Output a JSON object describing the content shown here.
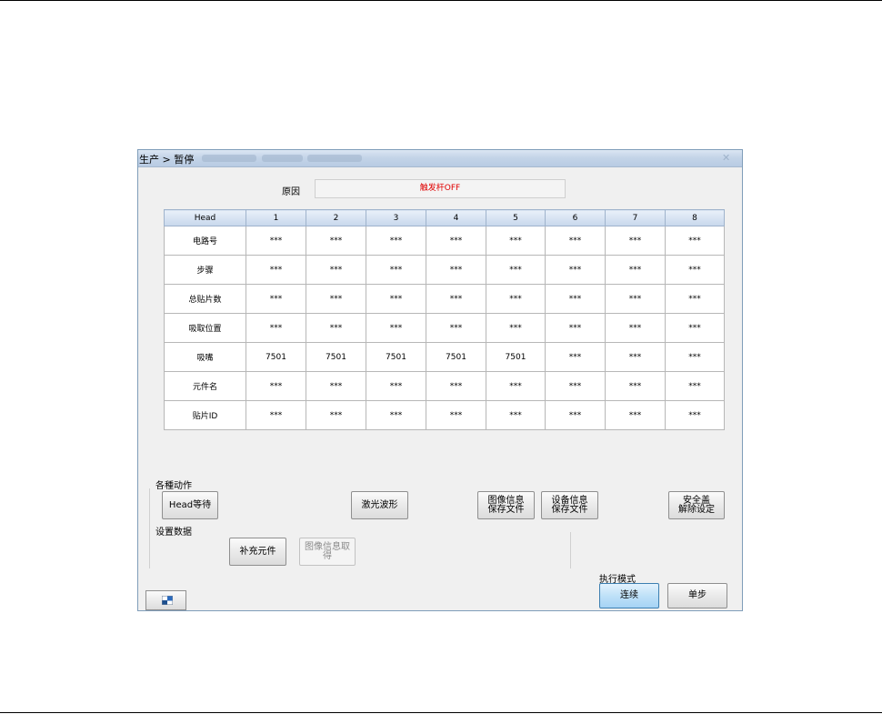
{
  "window": {
    "title": "生产 > 暂停"
  },
  "cause": {
    "label": "原因",
    "value": "触发杆OFF"
  },
  "table": {
    "columns": [
      "Head",
      "1",
      "2",
      "3",
      "4",
      "5",
      "6",
      "7",
      "8"
    ],
    "rows": [
      {
        "label": "电路号",
        "cells": [
          "***",
          "***",
          "***",
          "***",
          "***",
          "***",
          "***",
          "***"
        ]
      },
      {
        "label": "步骤",
        "cells": [
          "***",
          "***",
          "***",
          "***",
          "***",
          "***",
          "***",
          "***"
        ]
      },
      {
        "label": "总贴片数",
        "cells": [
          "***",
          "***",
          "***",
          "***",
          "***",
          "***",
          "***",
          "***"
        ]
      },
      {
        "label": "吸取位置",
        "cells": [
          "***",
          "***",
          "***",
          "***",
          "***",
          "***",
          "***",
          "***"
        ]
      },
      {
        "label": "吸嘴",
        "cells": [
          "7501",
          "7501",
          "7501",
          "7501",
          "7501",
          "***",
          "***",
          "***"
        ]
      },
      {
        "label": "元件名",
        "cells": [
          "***",
          "***",
          "***",
          "***",
          "***",
          "***",
          "***",
          "***"
        ]
      },
      {
        "label": "贴片ID",
        "cells": [
          "***",
          "***",
          "***",
          "***",
          "***",
          "***",
          "***",
          "***"
        ]
      }
    ]
  },
  "actions": {
    "section_label": "各種动作",
    "head_wait": "Head等待",
    "laser_wave": "激光波形",
    "save_image_info": "图像信息\n保存文件",
    "save_device_info": "设备信息\n保存文件",
    "release_safety": "安全盖\n解除设定"
  },
  "settings": {
    "section_label": "设置数据",
    "supplement_part": "补充元件",
    "get_image_info": "图像信息取得"
  },
  "mode": {
    "label": "执行模式",
    "continuous": "连续",
    "step": "单步"
  }
}
